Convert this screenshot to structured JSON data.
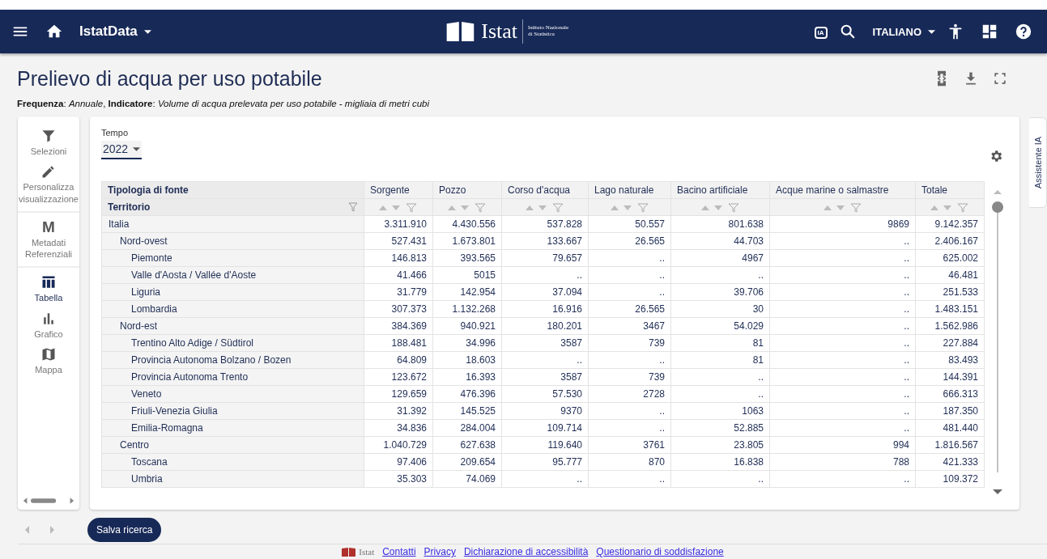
{
  "header": {
    "app_name": "IstatData",
    "logo_name": "Istat",
    "logo_subtitle": [
      "Istituto Nazionale",
      "di Statistica"
    ],
    "ai_label": "IA",
    "language": "ITALIANO"
  },
  "page": {
    "title": "Prelievo di acqua per uso potabile",
    "subtitle": "**Frequenza**: *Annuale*, **Indicatore**: *Volume di acqua prelevata per uso potabile - migliaia di metri cubi*"
  },
  "sidebar": {
    "items": [
      {
        "label": "Selezioni",
        "kind": "filter",
        "selected": false
      },
      {
        "label": "Personalizza visualizzazione",
        "kind": "pencil",
        "selected": false
      },
      {
        "label": "Metadati Referenziali",
        "kind": "letter",
        "glyph": "M",
        "selected": false
      },
      {
        "label": "Tabella",
        "kind": "table",
        "selected": true
      },
      {
        "label": "Grafico",
        "kind": "chart",
        "selected": false
      },
      {
        "label": "Mappa",
        "kind": "map",
        "selected": false
      }
    ]
  },
  "filter": {
    "label": "Tempo",
    "value": "2022"
  },
  "table": {
    "column_header": "Tipologia di fonte",
    "row_header": "Territorio",
    "columns": [
      "Sorgente",
      "Pozzo",
      "Corso d'acqua",
      "Lago naturale",
      "Bacino artificiale",
      "Acque marine o salmastre",
      "Totale"
    ],
    "rows": [
      {
        "name": "Italia",
        "values": [
          "3.311.910",
          "4.430.556",
          "537.828",
          "50.557",
          "801.638",
          "9869",
          "9.142.357"
        ],
        "children": [
          {
            "name": "Nord-ovest",
            "values": [
              "527.431",
              "1.673.801",
              "133.667",
              "26.565",
              "44.703",
              "..",
              "2.406.167"
            ],
            "children": [
              {
                "name": "Piemonte",
                "values": [
                  "146.813",
                  "393.565",
                  "79.657",
                  "..",
                  "4967",
                  "..",
                  "625.002"
                ]
              },
              {
                "name": "Valle d'Aosta / Vallée d'Aoste",
                "values": [
                  "41.466",
                  "5015",
                  "..",
                  "..",
                  "..",
                  "..",
                  "46.481"
                ]
              },
              {
                "name": "Liguria",
                "values": [
                  "31.779",
                  "142.954",
                  "37.094",
                  "..",
                  "39.706",
                  "..",
                  "251.533"
                ]
              },
              {
                "name": "Lombardia",
                "values": [
                  "307.373",
                  "1.132.268",
                  "16.916",
                  "26.565",
                  "30",
                  "..",
                  "1.483.151"
                ]
              }
            ]
          },
          {
            "name": "Nord-est",
            "values": [
              "384.369",
              "940.921",
              "180.201",
              "3467",
              "54.029",
              "..",
              "1.562.986"
            ],
            "children": [
              {
                "name": "Trentino Alto Adige / Südtirol",
                "values": [
                  "188.481",
                  "34.996",
                  "3587",
                  "739",
                  "81",
                  "..",
                  "227.884"
                ]
              },
              {
                "name": "Provincia Autonoma Bolzano / Bozen",
                "values": [
                  "64.809",
                  "18.603",
                  "..",
                  "..",
                  "81",
                  "..",
                  "83.493"
                ]
              },
              {
                "name": "Provincia Autonoma Trento",
                "values": [
                  "123.672",
                  "16.393",
                  "3587",
                  "739",
                  "..",
                  "..",
                  "144.391"
                ]
              },
              {
                "name": "Veneto",
                "values": [
                  "129.659",
                  "476.396",
                  "57.530",
                  "2728",
                  "..",
                  "..",
                  "666.313"
                ]
              },
              {
                "name": "Friuli-Venezia Giulia",
                "values": [
                  "31.392",
                  "145.525",
                  "9370",
                  "..",
                  "1063",
                  "..",
                  "187.350"
                ]
              },
              {
                "name": "Emilia-Romagna",
                "values": [
                  "34.836",
                  "284.004",
                  "109.714",
                  "..",
                  "52.885",
                  "..",
                  "481.440"
                ]
              }
            ]
          },
          {
            "name": "Centro",
            "values": [
              "1.040.729",
              "627.638",
              "119.640",
              "3761",
              "23.805",
              "994",
              "1.816.567"
            ],
            "children": [
              {
                "name": "Toscana",
                "values": [
                  "97.406",
                  "209.654",
                  "95.777",
                  "870",
                  "16.838",
                  "788",
                  "421.333"
                ]
              },
              {
                "name": "Umbria",
                "values": [
                  "35.303",
                  "74.069",
                  "..",
                  "..",
                  "..",
                  "..",
                  "109.372"
                ]
              }
            ]
          }
        ]
      }
    ]
  },
  "save_button": "Salva ricerca",
  "assistant_tab": "Assistente IA",
  "footer": {
    "logo_name": "Istat",
    "links": [
      "Contatti",
      "Privacy",
      "Dichiarazione di accessibilità",
      "Questionario di soddisfazione"
    ]
  }
}
